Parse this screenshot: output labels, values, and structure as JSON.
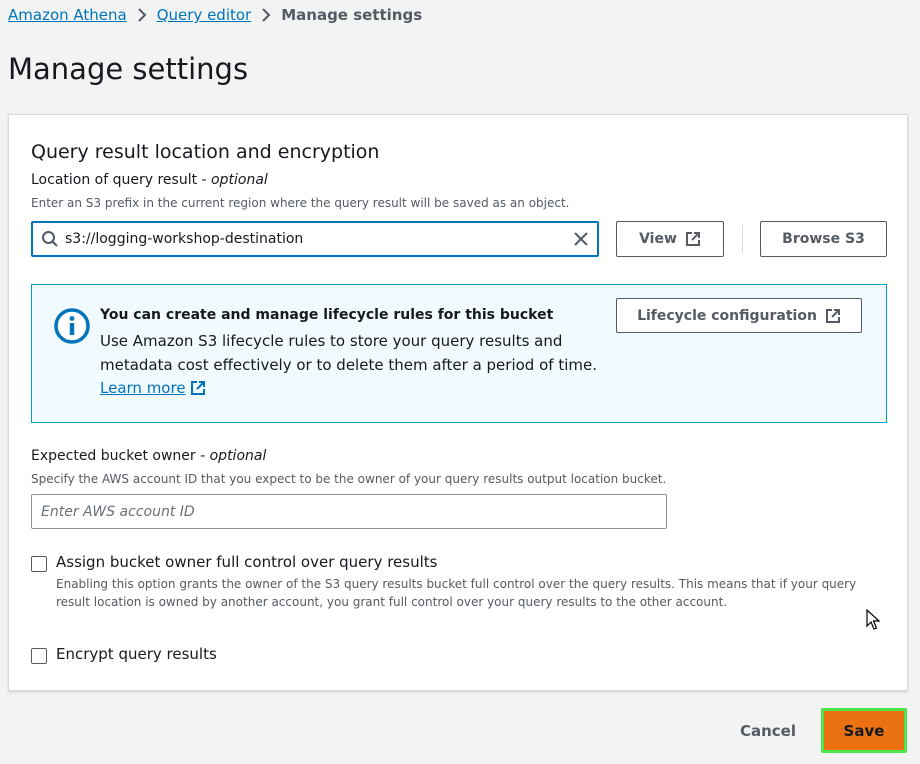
{
  "breadcrumb": {
    "items": [
      "Amazon Athena",
      "Query editor"
    ],
    "current": "Manage settings"
  },
  "page_title": "Manage settings",
  "section": {
    "title": "Query result location and encryption",
    "location": {
      "label": "Location of query result",
      "optional": "- optional",
      "description": "Enter an S3 prefix in the current region where the query result will be saved as an object.",
      "value": "s3://logging-workshop-destination",
      "view_label": "View",
      "browse_label": "Browse S3"
    },
    "info": {
      "title": "You can create and manage lifecycle rules for this bucket",
      "text": "Use Amazon S3 lifecycle rules to store your query results and metadata cost effectively or to delete them after a period of time.",
      "link": "Learn more",
      "button": "Lifecycle configuration"
    },
    "owner": {
      "label": "Expected bucket owner",
      "optional": "- optional",
      "description": "Specify the AWS account ID that you expect to be the owner of your query results output location bucket.",
      "placeholder": "Enter AWS account ID"
    },
    "full_control": {
      "label": "Assign bucket owner full control over query results",
      "description": "Enabling this option grants the owner of the S3 query results bucket full control over the query results. This means that if your query result location is owned by another account, you grant full control over your query results to the other account.",
      "checked": false
    },
    "encrypt": {
      "label": "Encrypt query results",
      "checked": false
    }
  },
  "actions": {
    "cancel": "Cancel",
    "save": "Save"
  },
  "colors": {
    "link": "#0073bb",
    "primary": "#ec7211",
    "highlight": "#4ce54c",
    "info_bg": "#f1faff",
    "info_border": "#00a1c9"
  }
}
